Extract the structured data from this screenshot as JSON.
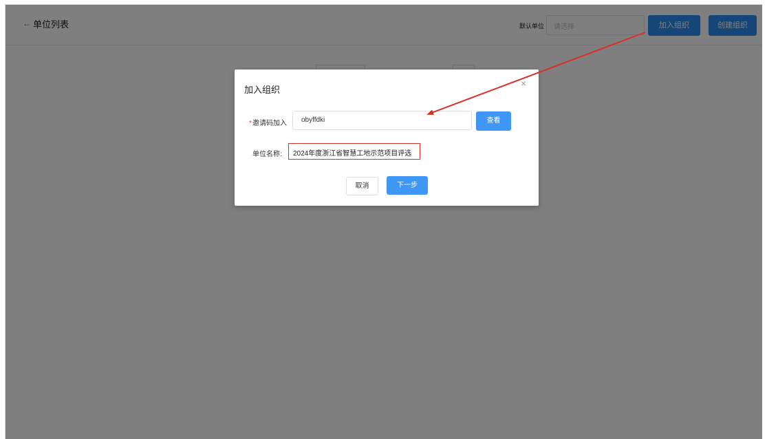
{
  "header": {
    "back_icon": "←",
    "title": "单位列表",
    "default_unit_label": "默认单位",
    "select_placeholder": "请选择",
    "join_button": "加入组织",
    "create_button": "创建组织"
  },
  "dialog": {
    "title": "加入组织",
    "close_icon": "×",
    "required_mark": "*",
    "invite_label": "邀请码加入",
    "invite_value": "obyffdki",
    "view_button": "查看",
    "org_name_label": "单位名称:",
    "org_name_value": "2024年度浙江省智慧工地示范项目评选",
    "cancel_button": "取消",
    "next_button": "下一步"
  },
  "colors": {
    "primary": "#2d8cf0",
    "annotation": "#d93025",
    "overlay": "rgba(0,0,0,0.5)"
  }
}
